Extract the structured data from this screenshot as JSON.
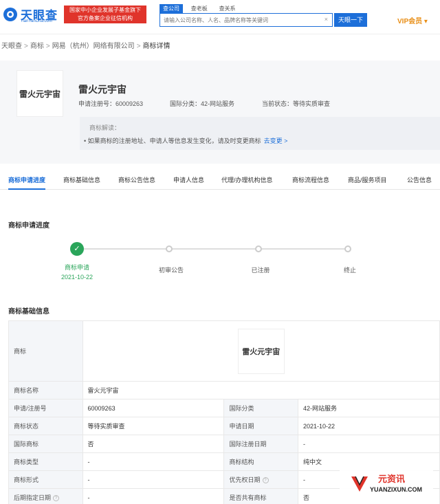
{
  "header": {
    "logo_text": "天眼查",
    "logo_sub": "TianYanCha.com",
    "badge_line1": "国家中小企业发展子基金旗下",
    "badge_line2": "官方备案企业征信机构",
    "search_tabs": [
      "查公司",
      "查老板",
      "查关系"
    ],
    "search_placeholder": "请输入公司名称、人名、品牌名称等关键词",
    "search_clear": "×",
    "search_button": "天眼一下",
    "vip_label": "VIP会员 ▾"
  },
  "breadcrumb": {
    "items": [
      "天眼查",
      "商标",
      "网易（杭州）网络有限公司",
      "商标详情"
    ],
    "sep": ">"
  },
  "summary": {
    "thumb_text": "雷火元宇宙",
    "name": "雷火元宇宙",
    "reg_no": "申请注册号：60009263",
    "intl_class": "国际分类：42-网站服务",
    "status": "当前状态：等待实质审查",
    "interp_title": "商标解读：",
    "interp_text": "• 如果商标的注册地址、申请人等信息发生变化，请及时变更商标",
    "interp_link": "去变更 >"
  },
  "tabs": [
    "商标申请进度",
    "商标基础信息",
    "商标公告信息",
    "申请人信息",
    "代理/办理机构信息",
    "商标流程信息",
    "商品/服务项目",
    "公告信息"
  ],
  "progress": {
    "title": "商标申请进度",
    "steps": [
      {
        "label": "商标申请",
        "date": "2021-10-22",
        "done": true
      },
      {
        "label": "初审公告",
        "date": "",
        "done": false
      },
      {
        "label": "已注册",
        "date": "",
        "done": false
      },
      {
        "label": "终止",
        "date": "",
        "done": false
      }
    ],
    "check": "✓"
  },
  "basic_info": {
    "title": "商标基础信息",
    "logo_label": "商标",
    "logo_text": "雷火元宇宙",
    "name_label": "商标名称",
    "name_value": "雷火元宇宙",
    "rows": [
      {
        "l1": "申请/注册号",
        "v1": "60009263",
        "l2": "国际分类",
        "v2": "42-网站服务"
      },
      {
        "l1": "商标状态",
        "v1": "等待实质审查",
        "l2": "申请日期",
        "v2": "2021-10-22"
      },
      {
        "l1": "国际商标",
        "v1": "否",
        "l2": "国际注册日期",
        "v2": "-"
      },
      {
        "l1": "商标类型",
        "v1": "-",
        "l2": "商标结构",
        "v2": "纯中文"
      },
      {
        "l1": "商标形式",
        "v1": "-",
        "l2": "优先权日期",
        "v2": "-"
      },
      {
        "l1": "后期指定日期",
        "v1": "-",
        "l2": "是否共有商标",
        "v2": "否"
      }
    ],
    "help": "?"
  },
  "watermark": {
    "cn": "元资讯",
    "en": "YUANZIXUN.COM"
  },
  "colors": {
    "brand_blue": "#1d6fd9",
    "badge_red": "#e0342b",
    "success_green": "#2aa55a",
    "vip_orange": "#e88d14"
  }
}
